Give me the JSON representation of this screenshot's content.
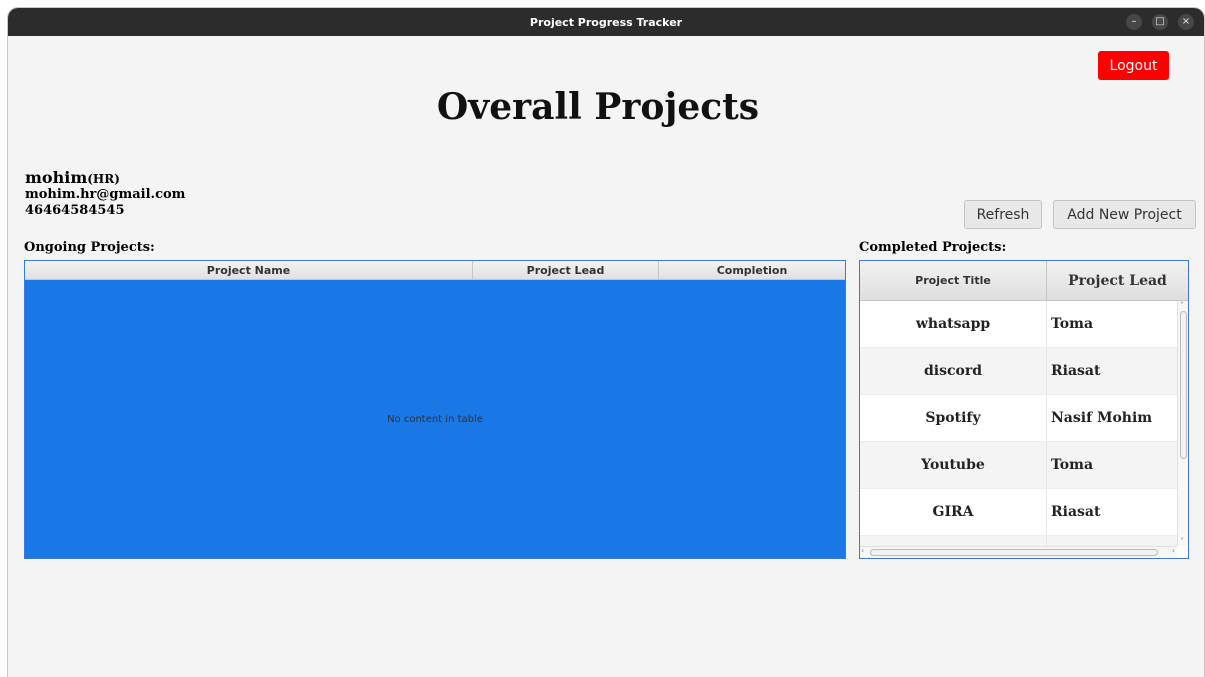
{
  "window": {
    "title": "Project Progress Tracker",
    "controls": {
      "minimize": "–",
      "maximize": "□",
      "close": "×"
    }
  },
  "header": {
    "logout_label": "Logout",
    "logout_color": "#ff0000",
    "page_title": "Overall Projects"
  },
  "user": {
    "name": "mohim",
    "role": "(HR)",
    "email": "mohim.hr@gmail.com",
    "phone": "46464584545"
  },
  "actions": {
    "refresh_label": "Refresh",
    "add_label": "Add New Project"
  },
  "ongoing": {
    "label": "Ongoing Projects:",
    "columns": [
      "Project Name",
      "Project Lead",
      "Completion"
    ],
    "empty_message": "No content in table",
    "selection_color": "#1a78e6"
  },
  "completed": {
    "label": "Completed Projects:",
    "columns": [
      "Project Title",
      "Project Lead"
    ],
    "rows": [
      {
        "title": "whatsapp",
        "lead": "Toma"
      },
      {
        "title": "discord",
        "lead": "Riasat"
      },
      {
        "title": "Spotify",
        "lead": "Nasif Mohim"
      },
      {
        "title": "Youtube",
        "lead": "Toma"
      },
      {
        "title": "GIRA",
        "lead": "Riasat"
      },
      {
        "title": "",
        "lead": ""
      }
    ]
  }
}
